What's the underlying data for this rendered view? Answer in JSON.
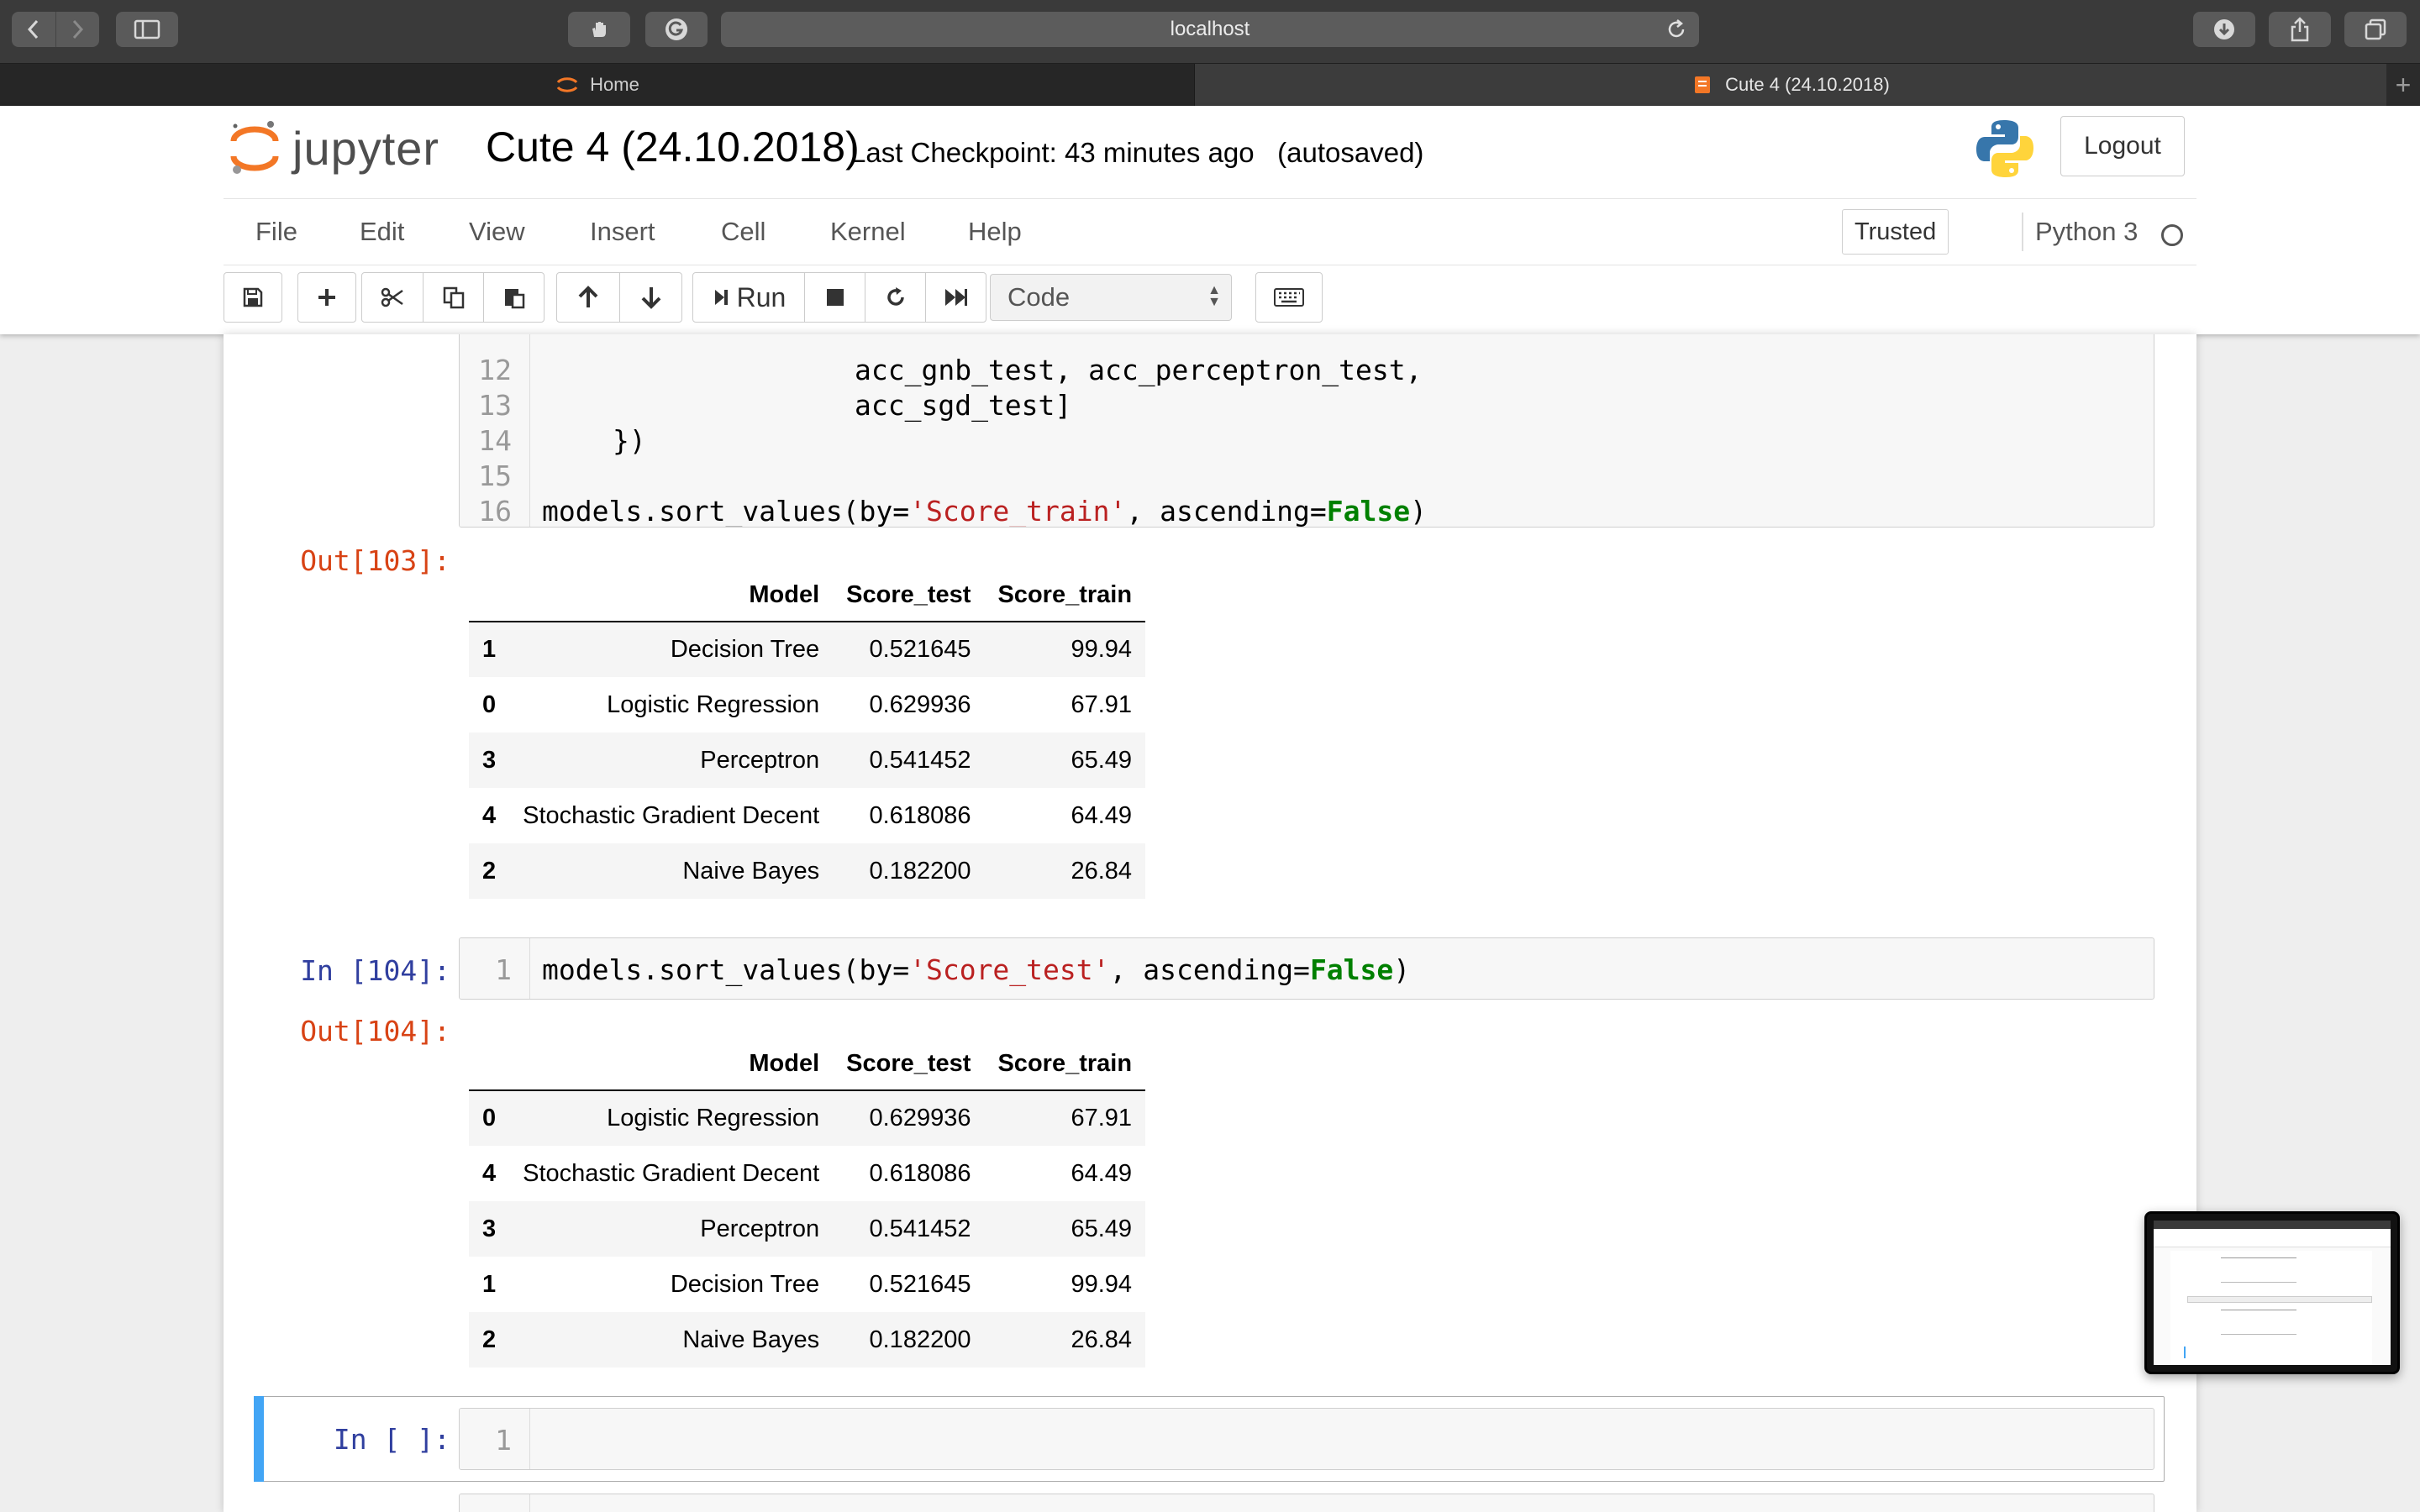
{
  "browser": {
    "address": "localhost",
    "tabs": [
      {
        "label": "Home"
      },
      {
        "label": "Cute 4 (24.10.2018)"
      }
    ],
    "new_tab": "+"
  },
  "header": {
    "logo_text": "jupyter",
    "notebook_title": "Cute 4 (24.10.2018)",
    "checkpoint": "Last Checkpoint: 43 minutes ago",
    "autosave": "(autosaved)",
    "logout_label": "Logout"
  },
  "menu": {
    "items": [
      "File",
      "Edit",
      "View",
      "Insert",
      "Cell",
      "Kernel",
      "Help"
    ],
    "trusted": "Trusted",
    "kernel_name": "Python 3"
  },
  "toolbar": {
    "run_label": "Run",
    "cell_type": "Code"
  },
  "cells": {
    "code_103": {
      "line_numbers": [
        "12",
        "13",
        "14",
        "15",
        "16"
      ],
      "lines": [
        "acc_gnb_test, acc_perceptron_test,",
        "acc_sgd_test]",
        "})",
        "",
        "models.sort_values(by='Score_train', ascending=False)"
      ],
      "last_line_parts": {
        "pre": "models.sort_values(by=",
        "str": "'Score_train'",
        "mid": ", ascending=",
        "kw": "False",
        "post": ")"
      }
    },
    "out_103": {
      "prompt": "Out[103]:",
      "columns": [
        "",
        "Model",
        "Score_test",
        "Score_train"
      ],
      "rows": [
        [
          "1",
          "Decision Tree",
          "0.521645",
          "99.94"
        ],
        [
          "0",
          "Logistic Regression",
          "0.629936",
          "67.91"
        ],
        [
          "3",
          "Perceptron",
          "0.541452",
          "65.49"
        ],
        [
          "4",
          "Stochastic Gradient Decent",
          "0.618086",
          "64.49"
        ],
        [
          "2",
          "Naive Bayes",
          "0.182200",
          "26.84"
        ]
      ]
    },
    "in_104": {
      "prompt": "In [104]:",
      "line_number": "1",
      "parts": {
        "pre": "models.sort_values(by=",
        "str": "'Score_test'",
        "mid": ", ascending=",
        "kw": "False",
        "post": ")"
      }
    },
    "out_104": {
      "prompt": "Out[104]:",
      "columns": [
        "",
        "Model",
        "Score_test",
        "Score_train"
      ],
      "rows": [
        [
          "0",
          "Logistic Regression",
          "0.629936",
          "67.91"
        ],
        [
          "4",
          "Stochastic Gradient Decent",
          "0.618086",
          "64.49"
        ],
        [
          "3",
          "Perceptron",
          "0.541452",
          "65.49"
        ],
        [
          "1",
          "Decision Tree",
          "0.521645",
          "99.94"
        ],
        [
          "2",
          "Naive Bayes",
          "0.182200",
          "26.84"
        ]
      ]
    },
    "in_empty": {
      "prompt": "In [ ]:",
      "line_number": "1"
    }
  },
  "colors": {
    "prompt_in": "#303f9f",
    "prompt_out": "#d84315",
    "string": "#ba2121",
    "keyword": "#008000",
    "active_cell": "#42a5f5",
    "jupyter_orange": "#f37726"
  }
}
